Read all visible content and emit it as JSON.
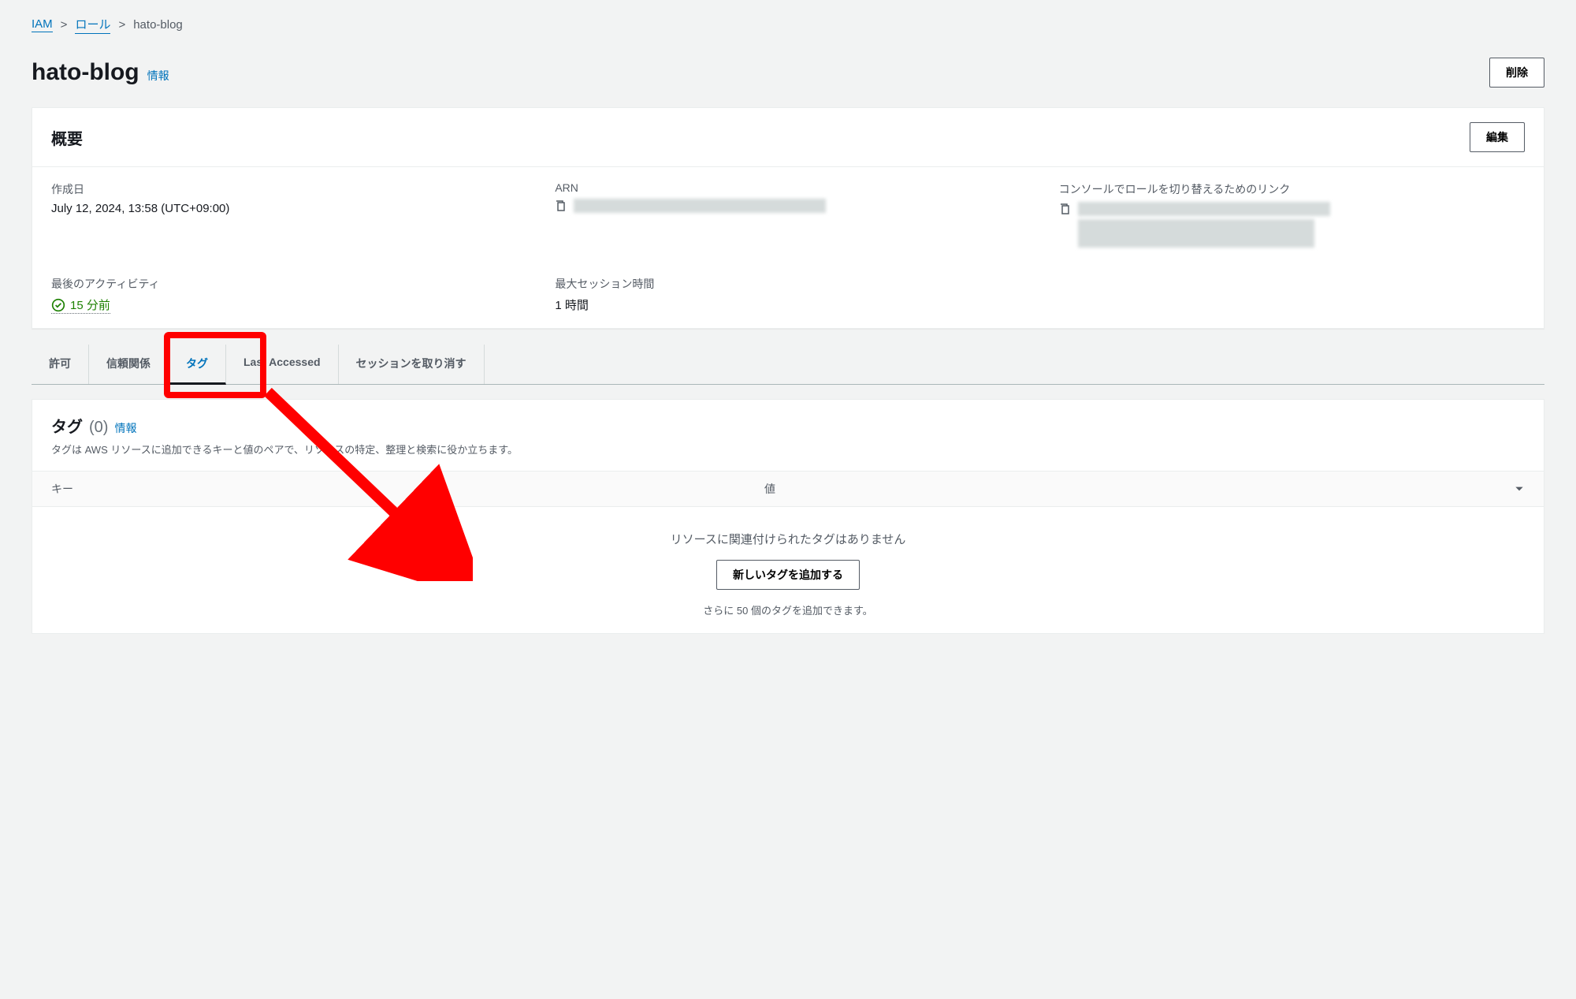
{
  "breadcrumb": {
    "root": "IAM",
    "section": "ロール",
    "current": "hato-blog"
  },
  "page": {
    "title": "hato-blog",
    "info": "情報",
    "deleteBtn": "削除"
  },
  "summary": {
    "title": "概要",
    "editBtn": "編集",
    "createdLabel": "作成日",
    "createdValue": "July 12, 2024, 13:58 (UTC+09:00)",
    "arnLabel": "ARN",
    "switchLinkLabel": "コンソールでロールを切り替えるためのリンク",
    "activityLabel": "最後のアクティビティ",
    "activityValue": "15 分前",
    "maxSessionLabel": "最大セッション時間",
    "maxSessionValue": "1 時間"
  },
  "tabs": {
    "permissions": "許可",
    "trust": "信頼関係",
    "tags": "タグ",
    "lastAccessed": "Last Accessed",
    "revoke": "セッションを取り消す"
  },
  "tagsSection": {
    "title": "タグ",
    "count": "(0)",
    "info": "情報",
    "desc": "タグは AWS リソースに追加できるキーと値のペアで、リソースの特定、整理と検索に役か立ちます。",
    "keyCol": "キー",
    "valueCol": "値",
    "emptyMsg": "リソースに関連付けられたタグはありません",
    "addBtn": "新しいタグを追加する",
    "footerMsg": "さらに 50 個のタグを追加できます。"
  }
}
